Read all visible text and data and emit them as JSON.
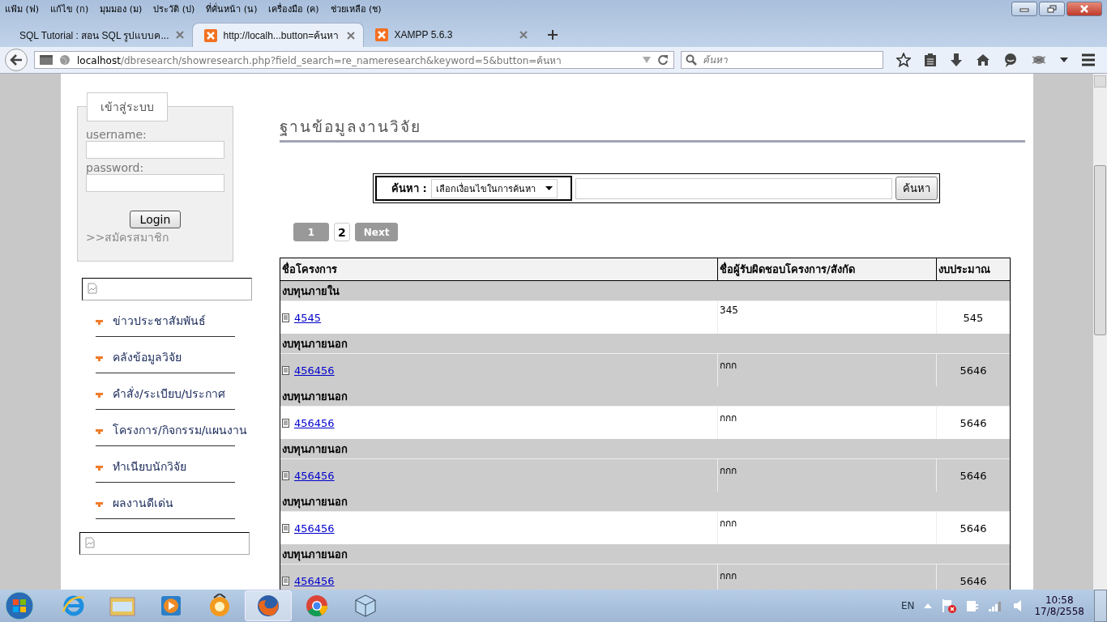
{
  "menu_bar": [
    "แฟ้ม (ฟ)",
    "แก้ไข (ก)",
    "มุมมอง (ม)",
    "ประวัติ (ป)",
    "ที่คั่นหน้า (น)",
    "เครื่องมือ (ค)",
    "ช่วยเหลือ (ช)"
  ],
  "tabs": [
    {
      "title": "SQL Tutorial : สอน SQL รูปแบบค...",
      "selected": false,
      "has_icon": false
    },
    {
      "title": "http://localh...button=ค้นหา",
      "selected": true,
      "has_icon": true
    },
    {
      "title": "XAMPP 5.6.3",
      "selected": false,
      "has_icon": true
    }
  ],
  "address_bar": {
    "host": "localhost",
    "path": "/dbresearch/showresearch.php?field_search=re_nameresearch&keyword=5&button=ค้นหา"
  },
  "search_box": {
    "placeholder": "ค้นหา"
  },
  "login": {
    "legend": "เข้าสู่ระบบ",
    "username_label": "username:",
    "password_label": "password:",
    "button": "Login",
    "register_link": ">>สมัครสมาชิก"
  },
  "sidebar_menu": [
    "ข่าวประชาสัมพันธ์",
    "คลังข้อมูลวิจัย",
    "คำสั่ง/ระเบียบ/ประกาศ",
    "โครงการ/กิจกรรม/แผนงาน",
    "ทำเนียบนักวิจัย",
    "ผลงานดีเด่น"
  ],
  "page_title": "ฐานข้อมูลงานวิจัย",
  "search_form": {
    "label": "ค้นหา :",
    "select_value": "เลือกเงื่อนไขในการค้นหา",
    "button": "ค้นหา"
  },
  "pagination": [
    {
      "label": "1",
      "selected": false
    },
    {
      "label": "2",
      "selected": true
    },
    {
      "label": "Next",
      "selected": false
    }
  ],
  "table": {
    "columns": [
      "ชื่อโครงการ",
      "ชื่อผู้รับผิดชอบโครงการ/สังกัด",
      "งบประมาณ"
    ],
    "rows": [
      {
        "category": "งบทุนภายใน",
        "project": "4545",
        "responsible": "345",
        "budget": "545"
      },
      {
        "category": "งบทุนภายนอก",
        "project": "456456",
        "responsible": "กกก",
        "budget": "5646"
      },
      {
        "category": "งบทุนภายนอก",
        "project": "456456",
        "responsible": "กกก",
        "budget": "5646"
      },
      {
        "category": "งบทุนภายนอก",
        "project": "456456",
        "responsible": "กกก",
        "budget": "5646"
      },
      {
        "category": "งบทุนภายนอก",
        "project": "456456",
        "responsible": "กกก",
        "budget": "5646"
      },
      {
        "category": "งบทุนภายนอก",
        "project": "456456",
        "responsible": "กกก",
        "budget": "5646"
      }
    ]
  },
  "taskbar": {
    "apps": [
      {
        "kind": "ie",
        "selected": false
      },
      {
        "kind": "folder",
        "selected": false
      },
      {
        "kind": "media",
        "selected": false
      },
      {
        "kind": "orange",
        "selected": false
      },
      {
        "kind": "firefox",
        "selected": true
      },
      {
        "kind": "chrome",
        "selected": false
      },
      {
        "kind": "cube",
        "selected": false
      }
    ],
    "language": "EN",
    "time": "10:58",
    "date": "17/8/2558"
  }
}
